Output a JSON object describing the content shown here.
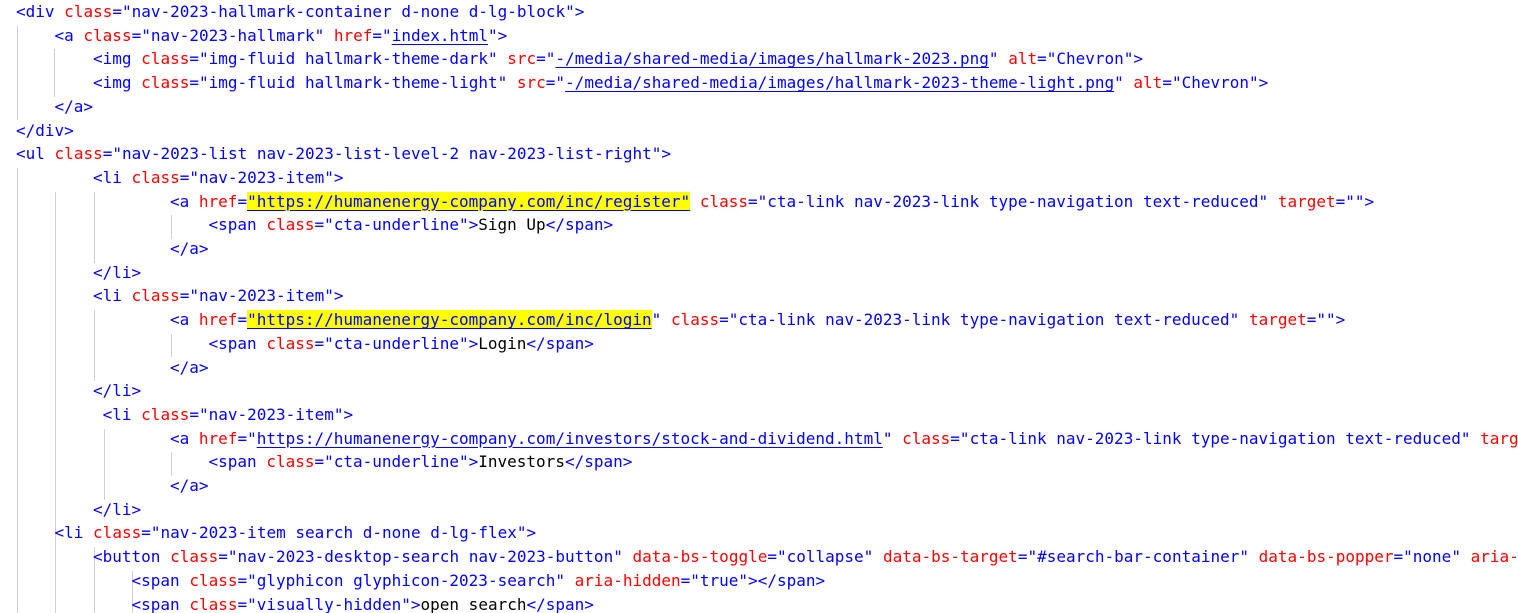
{
  "code_view": {
    "lines": [
      {
        "indent": 0,
        "tokens": [
          {
            "t": "tag",
            "v": "<div"
          },
          {
            "t": "txt",
            "v": " "
          },
          {
            "t": "attr",
            "v": "class"
          },
          {
            "t": "tag",
            "v": "=\""
          },
          {
            "t": "val",
            "v": "nav-2023-hallmark-container d-none d-lg-block"
          },
          {
            "t": "tag",
            "v": "\">"
          }
        ]
      },
      {
        "indent": 1,
        "tokens": [
          {
            "t": "tag",
            "v": "<a"
          },
          {
            "t": "txt",
            "v": " "
          },
          {
            "t": "attr",
            "v": "class"
          },
          {
            "t": "tag",
            "v": "=\""
          },
          {
            "t": "val",
            "v": "nav-2023-hallmark"
          },
          {
            "t": "tag",
            "v": "\""
          },
          {
            "t": "txt",
            "v": " "
          },
          {
            "t": "attr",
            "v": "href"
          },
          {
            "t": "tag",
            "v": "=\""
          },
          {
            "t": "link",
            "v": "index.html"
          },
          {
            "t": "tag",
            "v": "\">"
          }
        ]
      },
      {
        "indent": 2,
        "tokens": [
          {
            "t": "tag",
            "v": "<img"
          },
          {
            "t": "txt",
            "v": " "
          },
          {
            "t": "attr",
            "v": "class"
          },
          {
            "t": "tag",
            "v": "=\""
          },
          {
            "t": "val",
            "v": "img-fluid hallmark-theme-dark"
          },
          {
            "t": "tag",
            "v": "\""
          },
          {
            "t": "txt",
            "v": " "
          },
          {
            "t": "attr",
            "v": "src"
          },
          {
            "t": "tag",
            "v": "=\""
          },
          {
            "t": "link",
            "v": "-/media/shared-media/images/hallmark-2023.png"
          },
          {
            "t": "tag",
            "v": "\""
          },
          {
            "t": "txt",
            "v": " "
          },
          {
            "t": "attr",
            "v": "alt"
          },
          {
            "t": "tag",
            "v": "=\""
          },
          {
            "t": "val",
            "v": "Chevron"
          },
          {
            "t": "tag",
            "v": "\">"
          }
        ]
      },
      {
        "indent": 2,
        "tokens": [
          {
            "t": "tag",
            "v": "<img"
          },
          {
            "t": "txt",
            "v": " "
          },
          {
            "t": "attr",
            "v": "class"
          },
          {
            "t": "tag",
            "v": "=\""
          },
          {
            "t": "val",
            "v": "img-fluid hallmark-theme-light"
          },
          {
            "t": "tag",
            "v": "\""
          },
          {
            "t": "txt",
            "v": " "
          },
          {
            "t": "attr",
            "v": "src"
          },
          {
            "t": "tag",
            "v": "=\""
          },
          {
            "t": "link",
            "v": "-/media/shared-media/images/hallmark-2023-theme-light.png"
          },
          {
            "t": "tag",
            "v": "\""
          },
          {
            "t": "txt",
            "v": " "
          },
          {
            "t": "attr",
            "v": "alt"
          },
          {
            "t": "tag",
            "v": "=\""
          },
          {
            "t": "val",
            "v": "Chevron"
          },
          {
            "t": "tag",
            "v": "\">"
          }
        ]
      },
      {
        "indent": 1,
        "tokens": [
          {
            "t": "tag",
            "v": "</a>"
          }
        ]
      },
      {
        "indent": 0,
        "tokens": [
          {
            "t": "tag",
            "v": "</div>"
          }
        ]
      },
      {
        "indent": 0,
        "tokens": [
          {
            "t": "tag",
            "v": "<ul"
          },
          {
            "t": "txt",
            "v": " "
          },
          {
            "t": "attr",
            "v": "class"
          },
          {
            "t": "tag",
            "v": "=\""
          },
          {
            "t": "val",
            "v": "nav-2023-list nav-2023-list-level-2 nav-2023-list-right"
          },
          {
            "t": "tag",
            "v": "\">"
          }
        ]
      },
      {
        "indent": 2,
        "tokens": [
          {
            "t": "tag",
            "v": "<li"
          },
          {
            "t": "txt",
            "v": " "
          },
          {
            "t": "attr",
            "v": "class"
          },
          {
            "t": "tag",
            "v": "=\""
          },
          {
            "t": "val",
            "v": "nav-2023-item"
          },
          {
            "t": "tag",
            "v": "\">"
          }
        ]
      },
      {
        "indent": 4,
        "tokens": [
          {
            "t": "tag",
            "v": "<a"
          },
          {
            "t": "txt",
            "v": " "
          },
          {
            "t": "attr",
            "v": "href"
          },
          {
            "t": "tag",
            "v": "="
          },
          {
            "t": "hl",
            "v": "\"https://humanenergy-company.com/inc/register\""
          },
          {
            "t": "txt",
            "v": " "
          },
          {
            "t": "attr",
            "v": "class"
          },
          {
            "t": "tag",
            "v": "=\""
          },
          {
            "t": "val",
            "v": "cta-link nav-2023-link type-navigation text-reduced"
          },
          {
            "t": "tag",
            "v": "\""
          },
          {
            "t": "txt",
            "v": " "
          },
          {
            "t": "attr",
            "v": "target"
          },
          {
            "t": "tag",
            "v": "=\"\">"
          }
        ]
      },
      {
        "indent": 5,
        "tokens": [
          {
            "t": "tag",
            "v": "<span"
          },
          {
            "t": "txt",
            "v": " "
          },
          {
            "t": "attr",
            "v": "class"
          },
          {
            "t": "tag",
            "v": "=\""
          },
          {
            "t": "val",
            "v": "cta-underline"
          },
          {
            "t": "tag",
            "v": "\">"
          },
          {
            "t": "txt",
            "v": "Sign Up"
          },
          {
            "t": "tag",
            "v": "</span>"
          }
        ]
      },
      {
        "indent": 4,
        "tokens": [
          {
            "t": "tag",
            "v": "</a>"
          }
        ]
      },
      {
        "indent": 2,
        "tokens": [
          {
            "t": "tag",
            "v": "</li>"
          }
        ]
      },
      {
        "indent": 2,
        "tokens": [
          {
            "t": "tag",
            "v": "<li"
          },
          {
            "t": "txt",
            "v": " "
          },
          {
            "t": "attr",
            "v": "class"
          },
          {
            "t": "tag",
            "v": "=\""
          },
          {
            "t": "val",
            "v": "nav-2023-item"
          },
          {
            "t": "tag",
            "v": "\">"
          }
        ]
      },
      {
        "indent": 4,
        "tokens": [
          {
            "t": "tag",
            "v": "<a"
          },
          {
            "t": "txt",
            "v": " "
          },
          {
            "t": "attr",
            "v": "href"
          },
          {
            "t": "tag",
            "v": "="
          },
          {
            "t": "hl",
            "v": "\"https://humanenergy-company.com/inc/login"
          },
          {
            "t": "tag",
            "v": "\""
          },
          {
            "t": "txt",
            "v": " "
          },
          {
            "t": "attr",
            "v": "class"
          },
          {
            "t": "tag",
            "v": "=\""
          },
          {
            "t": "val",
            "v": "cta-link nav-2023-link type-navigation text-reduced"
          },
          {
            "t": "tag",
            "v": "\""
          },
          {
            "t": "txt",
            "v": " "
          },
          {
            "t": "attr",
            "v": "target"
          },
          {
            "t": "tag",
            "v": "=\"\">"
          }
        ]
      },
      {
        "indent": 5,
        "tokens": [
          {
            "t": "tag",
            "v": "<span"
          },
          {
            "t": "txt",
            "v": " "
          },
          {
            "t": "attr",
            "v": "class"
          },
          {
            "t": "tag",
            "v": "=\""
          },
          {
            "t": "val",
            "v": "cta-underline"
          },
          {
            "t": "tag",
            "v": "\">"
          },
          {
            "t": "txt",
            "v": "Login"
          },
          {
            "t": "tag",
            "v": "</span>"
          }
        ]
      },
      {
        "indent": 4,
        "tokens": [
          {
            "t": "tag",
            "v": "</a>"
          }
        ]
      },
      {
        "indent": 2,
        "tokens": [
          {
            "t": "tag",
            "v": "</li>"
          }
        ]
      },
      {
        "indent": 2.25,
        "tokens": [
          {
            "t": "tag",
            "v": "<li"
          },
          {
            "t": "txt",
            "v": " "
          },
          {
            "t": "attr",
            "v": "class"
          },
          {
            "t": "tag",
            "v": "=\""
          },
          {
            "t": "val",
            "v": "nav-2023-item"
          },
          {
            "t": "tag",
            "v": "\">"
          }
        ]
      },
      {
        "indent": 4,
        "tokens": [
          {
            "t": "tag",
            "v": "<a"
          },
          {
            "t": "txt",
            "v": " "
          },
          {
            "t": "attr",
            "v": "href"
          },
          {
            "t": "tag",
            "v": "=\""
          },
          {
            "t": "link",
            "v": "https://humanenergy-company.com/investors/stock-and-dividend.html"
          },
          {
            "t": "tag",
            "v": "\""
          },
          {
            "t": "txt",
            "v": " "
          },
          {
            "t": "attr",
            "v": "class"
          },
          {
            "t": "tag",
            "v": "=\""
          },
          {
            "t": "val",
            "v": "cta-link nav-2023-link type-navigation text-reduced"
          },
          {
            "t": "tag",
            "v": "\""
          },
          {
            "t": "txt",
            "v": " "
          },
          {
            "t": "attr",
            "v": "targe"
          }
        ]
      },
      {
        "indent": 5,
        "tokens": [
          {
            "t": "tag",
            "v": "<span"
          },
          {
            "t": "txt",
            "v": " "
          },
          {
            "t": "attr",
            "v": "class"
          },
          {
            "t": "tag",
            "v": "=\""
          },
          {
            "t": "val",
            "v": "cta-underline"
          },
          {
            "t": "tag",
            "v": "\">"
          },
          {
            "t": "txt",
            "v": "Investors"
          },
          {
            "t": "tag",
            "v": "</span>"
          }
        ]
      },
      {
        "indent": 4,
        "tokens": [
          {
            "t": "tag",
            "v": "</a>"
          }
        ]
      },
      {
        "indent": 2,
        "tokens": [
          {
            "t": "tag",
            "v": "</li>"
          }
        ]
      },
      {
        "indent": 1,
        "tokens": [
          {
            "t": "tag",
            "v": "<li"
          },
          {
            "t": "txt",
            "v": " "
          },
          {
            "t": "attr",
            "v": "class"
          },
          {
            "t": "tag",
            "v": "=\""
          },
          {
            "t": "val",
            "v": "nav-2023-item search d-none d-lg-flex"
          },
          {
            "t": "tag",
            "v": "\">"
          }
        ]
      },
      {
        "indent": 2,
        "tokens": [
          {
            "t": "tag",
            "v": "<button"
          },
          {
            "t": "txt",
            "v": " "
          },
          {
            "t": "attr",
            "v": "class"
          },
          {
            "t": "tag",
            "v": "=\""
          },
          {
            "t": "val",
            "v": "nav-2023-desktop-search nav-2023-button"
          },
          {
            "t": "tag",
            "v": "\""
          },
          {
            "t": "txt",
            "v": " "
          },
          {
            "t": "attr",
            "v": "data-bs-toggle"
          },
          {
            "t": "tag",
            "v": "=\""
          },
          {
            "t": "val",
            "v": "collapse"
          },
          {
            "t": "tag",
            "v": "\""
          },
          {
            "t": "txt",
            "v": " "
          },
          {
            "t": "attr",
            "v": "data-bs-target"
          },
          {
            "t": "tag",
            "v": "=\""
          },
          {
            "t": "val",
            "v": "#search-bar-container"
          },
          {
            "t": "tag",
            "v": "\""
          },
          {
            "t": "txt",
            "v": " "
          },
          {
            "t": "attr",
            "v": "data-bs-popper"
          },
          {
            "t": "tag",
            "v": "=\""
          },
          {
            "t": "val",
            "v": "none"
          },
          {
            "t": "tag",
            "v": "\""
          },
          {
            "t": "txt",
            "v": " "
          },
          {
            "t": "attr",
            "v": "aria-"
          }
        ]
      },
      {
        "indent": 3,
        "tokens": [
          {
            "t": "tag",
            "v": "<span"
          },
          {
            "t": "txt",
            "v": " "
          },
          {
            "t": "attr",
            "v": "class"
          },
          {
            "t": "tag",
            "v": "=\""
          },
          {
            "t": "val",
            "v": "glyphicon glyphicon-2023-search"
          },
          {
            "t": "tag",
            "v": "\""
          },
          {
            "t": "txt",
            "v": " "
          },
          {
            "t": "attr",
            "v": "aria-hidden"
          },
          {
            "t": "tag",
            "v": "=\""
          },
          {
            "t": "val",
            "v": "true"
          },
          {
            "t": "tag",
            "v": "\"></span>"
          }
        ]
      },
      {
        "indent": 3,
        "tokens": [
          {
            "t": "tag",
            "v": "<span"
          },
          {
            "t": "txt",
            "v": " "
          },
          {
            "t": "attr",
            "v": "class"
          },
          {
            "t": "tag",
            "v": "=\""
          },
          {
            "t": "val",
            "v": "visually-hidden"
          },
          {
            "t": "tag",
            "v": "\">"
          },
          {
            "t": "txt",
            "v": "open search"
          },
          {
            "t": "tag",
            "v": "</span>"
          }
        ]
      }
    ],
    "colors": {
      "tag": "#0000ff",
      "attribute": "#ff0000",
      "value": "#0000ff",
      "highlight": "#ffff00",
      "guide": "#d0d0d0"
    }
  }
}
